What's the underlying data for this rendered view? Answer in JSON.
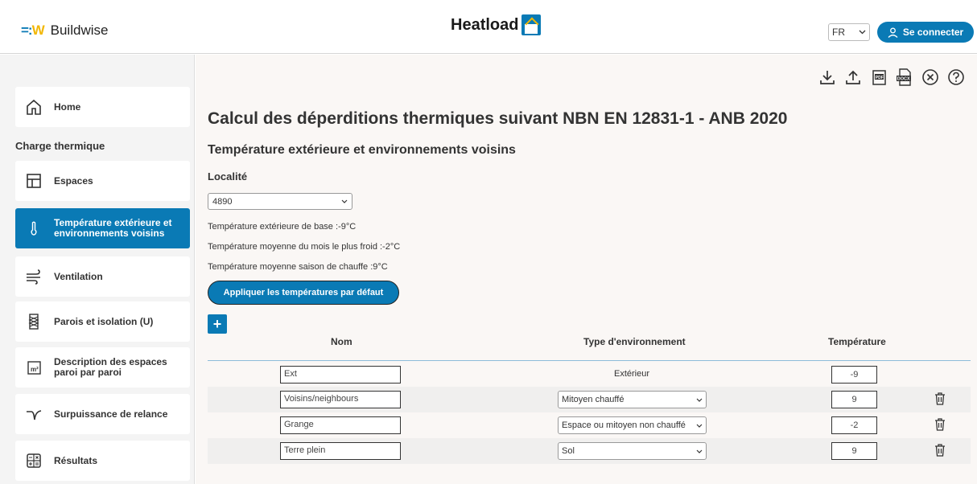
{
  "header": {
    "logo_text": "Buildwise",
    "brand_title": "Heatload",
    "language": "FR",
    "login_label": "Se connecter"
  },
  "sidebar": {
    "section_label": "Charge thermique",
    "items": [
      {
        "label": "Home",
        "icon": "home-icon"
      },
      {
        "label": "Espaces",
        "icon": "layout-icon"
      },
      {
        "label": "Température extérieure et environnements voisins",
        "icon": "thermometer-icon",
        "active": true
      },
      {
        "label": "Ventilation",
        "icon": "wind-icon"
      },
      {
        "label": "Parois et isolation (U)",
        "icon": "insulation-icon"
      },
      {
        "label": "Description des espaces paroi par paroi",
        "icon": "area-icon"
      },
      {
        "label": "Surpuissance de relance",
        "icon": "curve-icon"
      },
      {
        "label": "Résultats",
        "icon": "calculator-icon"
      }
    ]
  },
  "toolbar": {
    "icons": [
      "download-icon",
      "upload-icon",
      "pdf-icon",
      "docx-icon",
      "close-circle-icon",
      "help-icon"
    ],
    "pdf_label": "PDF",
    "docx_label": "DOCX"
  },
  "main": {
    "page_title": "Calcul des déperditions thermiques suivant NBN EN 12831-1 - ANB 2020",
    "section_title": "Température extérieure et environnements voisins",
    "locality_label": "Localité",
    "locality_value": "4890",
    "info": [
      "Température extérieure de base :-9°C",
      "Température moyenne du mois le plus froid :-2°C",
      "Température moyenne saison de chauffe :9°C"
    ],
    "apply_label": "Appliquer les températures par défaut",
    "add_label": "+"
  },
  "table": {
    "headers": {
      "name": "Nom",
      "type": "Type d'environnement",
      "temp": "Température"
    },
    "rows": [
      {
        "name": "Ext",
        "type": "Extérieur",
        "type_is_select": false,
        "temp": "-9",
        "deletable": false
      },
      {
        "name": "Voisins/neighbours",
        "type": "Mitoyen chauffé",
        "type_is_select": true,
        "temp": "9",
        "deletable": true
      },
      {
        "name": "Grange",
        "type": "Espace ou mitoyen non chauffé",
        "type_is_select": true,
        "temp": "-2",
        "deletable": true
      },
      {
        "name": "Terre plein",
        "type": "Sol",
        "type_is_select": true,
        "temp": "9",
        "deletable": true
      }
    ]
  },
  "colors": {
    "accent": "#0a7ab5",
    "brand_yellow": "#f2b705"
  }
}
